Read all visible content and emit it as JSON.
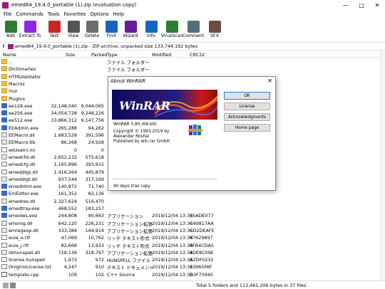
{
  "window": {
    "title": "emed64_19.4.0_portable (1).zip (evaluation copy)"
  },
  "menu": [
    "File",
    "Commands",
    "Tools",
    "Favorites",
    "Options",
    "Help"
  ],
  "toolbar": [
    {
      "label": "Add",
      "icon": "add-icon",
      "color": "#2e7d32"
    },
    {
      "label": "Extract To",
      "icon": "extract-to-icon",
      "color": "#8a2be2"
    },
    {
      "label": "Test",
      "icon": "test-icon",
      "color": "#c62828"
    },
    {
      "label": "View",
      "icon": "view-icon",
      "color": "#555555"
    },
    {
      "label": "Delete",
      "icon": "delete-icon",
      "color": "#6d6d6d"
    },
    {
      "label": "Find",
      "icon": "find-icon",
      "color": "#1565c0"
    },
    {
      "label": "Wizard",
      "icon": "wizard-icon",
      "color": "#6a1b9a"
    },
    {
      "label": "Info",
      "icon": "info-icon",
      "color": "#1565c0"
    },
    {
      "label": "VirusScan",
      "icon": "virusscan-icon",
      "color": "#2e7d32"
    },
    {
      "label": "Comment",
      "icon": "comment-icon",
      "color": "#546e7a"
    },
    {
      "label": "SFX",
      "icon": "sfx-icon",
      "color": "#6d4c41"
    }
  ],
  "address": {
    "text": "emed64_19.4.0_portable (1).zip - ZIP archive, unpacked size 133,744,192 bytes"
  },
  "columns": {
    "name": "Name",
    "size": "Size",
    "packed": "Packed",
    "type": "Type",
    "modified": "Modified",
    "crc": "CRC32"
  },
  "files": [
    {
      "name": "..",
      "size": "",
      "packed": "",
      "type": "ファイル フォルダー",
      "modified": "",
      "crc": "",
      "kind": "folder"
    },
    {
      "name": "Dictionaries",
      "size": "",
      "packed": "",
      "type": "ファイル フォルダー",
      "modified": "",
      "crc": "",
      "kind": "folder"
    },
    {
      "name": "HTMLValidator",
      "size": "",
      "packed": "",
      "type": "",
      "modified": "",
      "crc": "",
      "kind": "folder"
    },
    {
      "name": "Macros",
      "size": "",
      "packed": "",
      "type": "",
      "modified": "",
      "crc": "",
      "kind": "folder"
    },
    {
      "name": "mui",
      "size": "",
      "packed": "",
      "type": "",
      "modified": "",
      "crc": "",
      "kind": "folder"
    },
    {
      "name": "PlugIns",
      "size": "",
      "packed": "",
      "type": "",
      "modified": "",
      "crc": "",
      "kind": "folder"
    },
    {
      "name": "ee128.exe",
      "size": "32,148,040",
      "packed": "9,044,065",
      "type": "",
      "modified": "",
      "crc": "",
      "kind": "exe"
    },
    {
      "name": "ee256.exe",
      "size": "34,054,728",
      "packed": "9,248,226",
      "type": "",
      "modified": "",
      "crc": "",
      "kind": "exe"
    },
    {
      "name": "ee512.exe",
      "size": "33,866,312",
      "packed": "9,147,756",
      "type": "",
      "modified": "",
      "crc": "",
      "kind": "exe"
    },
    {
      "name": "EEAdmin.exe",
      "size": "265,288",
      "packed": "94,262",
      "type": "",
      "modified": "",
      "crc": "",
      "kind": "exe"
    },
    {
      "name": "EEMacro.dll",
      "size": "1,683,528",
      "packed": "391,596",
      "type": "",
      "modified": "",
      "crc": "",
      "kind": "dll"
    },
    {
      "name": "EEMacro.tlb",
      "size": "86,268",
      "packed": "24,928",
      "type": "",
      "modified": "",
      "crc": "",
      "kind": "dll"
    },
    {
      "name": "eeUseIni.ini",
      "size": "0",
      "packed": "0",
      "type": "",
      "modified": "",
      "crc": "",
      "kind": "txt"
    },
    {
      "name": "emedcfd.dll",
      "size": "2,652,232",
      "packed": "575,618",
      "type": "",
      "modified": "",
      "crc": "",
      "kind": "dll"
    },
    {
      "name": "emedcfg.dll",
      "size": "1,165,896",
      "packed": "393,915",
      "type": "",
      "modified": "",
      "crc": "",
      "kind": "dll"
    },
    {
      "name": "emeddlgs.dll",
      "size": "1,416,264",
      "packed": "445,879",
      "type": "",
      "modified": "",
      "crc": "",
      "kind": "dll"
    },
    {
      "name": "emeddlgt.dll",
      "size": "937,544",
      "packed": "317,169",
      "type": "",
      "modified": "",
      "crc": "",
      "kind": "dll"
    },
    {
      "name": "emedhtml.exe",
      "size": "140,872",
      "packed": "71,740",
      "type": "",
      "modified": "",
      "crc": "",
      "kind": "exe"
    },
    {
      "name": "EmEditor.exe",
      "size": "161,352",
      "packed": "82,136",
      "type": "",
      "modified": "",
      "crc": "",
      "kind": "exe"
    },
    {
      "name": "emedres.dll",
      "size": "2,327,624",
      "packed": "516,470",
      "type": "",
      "modified": "",
      "crc": "",
      "kind": "dll"
    },
    {
      "name": "emedtray.exe",
      "size": "468,552",
      "packed": "183,257",
      "type": "",
      "modified": "",
      "crc": "",
      "kind": "exe"
    },
    {
      "name": "emedws.exe",
      "size": "244,808",
      "packed": "90,663",
      "type": "アプリケーション",
      "modified": "2019/12/04 13:36",
      "crc": "35ADE077",
      "kind": "exe"
    },
    {
      "name": "emonig.dll",
      "size": "642,120",
      "packed": "226,231",
      "type": "アプリケーション拡張",
      "modified": "2019/12/04 13:36",
      "crc": "C40817AA",
      "kind": "dll"
    },
    {
      "name": "emregexp.dll",
      "size": "333,384",
      "packed": "144,914",
      "type": "アプリケーション拡張",
      "modified": "2019/12/04 13:36",
      "crc": "CD2DEAFE",
      "kind": "dll"
    },
    {
      "name": "eula_e.rtf",
      "size": "47,069",
      "packed": "10,762",
      "type": "リッチ テキスト形式",
      "modified": "2019/12/04 13:36",
      "crc": "87629897",
      "kind": "txt"
    },
    {
      "name": "eula_j.rtf",
      "size": "82,668",
      "packed": "13,933",
      "type": "リッチ テキスト形式",
      "modified": "2019/12/04 13:36",
      "crc": "8FB4CDA5",
      "kind": "txt"
    },
    {
      "name": "libhunspell.dll",
      "size": "728,136",
      "packed": "318,797",
      "type": "アプリケーション拡張",
      "modified": "2019/12/04 13:36",
      "crc": "4DE8C09E",
      "kind": "dll"
    },
    {
      "name": "license.hunspell",
      "size": "1,973",
      "packed": "972",
      "type": "HUNSPELL ファイル",
      "modified": "2019/12/04 13:36",
      "crc": "A2DF0232",
      "kind": "txt"
    },
    {
      "name": "OnigmoLicense.txt",
      "size": "4,247",
      "packed": "910",
      "type": "テキスト ドキュメント",
      "modified": "2019/12/04 13:36",
      "crc": "13965FAF",
      "kind": "txt"
    },
    {
      "name": "template.cpp",
      "size": "109",
      "packed": "102",
      "type": "C++ Source",
      "modified": "2019/12/04 13:36",
      "crc": "D3F75945",
      "kind": "cpp"
    }
  ],
  "status": {
    "text": "Total 5 folders and 113,461,206 bytes in 37 files"
  },
  "dialog": {
    "title": "About WinRAR",
    "banner": "WinRAR",
    "version": "WinRAR 5.80 (64-bit)",
    "copyright": "Copyright © 1993-2019 by",
    "author": "Alexander Roshal",
    "publisher": "Published by win.rar GmbH",
    "trial": "40 days trial copy",
    "buttons": {
      "ok": "OK",
      "license": "License",
      "ack": "Acknowledgments",
      "home": "Home page"
    }
  }
}
